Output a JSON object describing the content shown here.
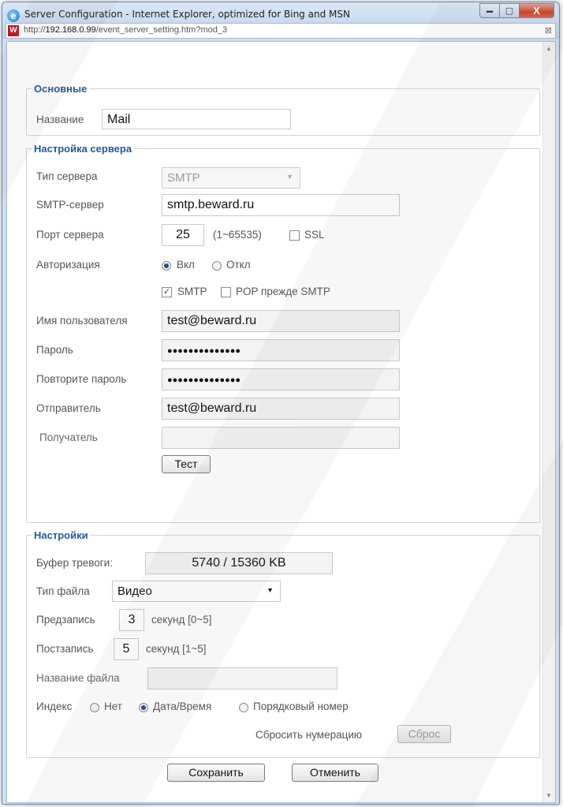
{
  "window": {
    "title": "Server Configuration - Internet Explorer, optimized for Bing and MSN",
    "url_prefix": "http://",
    "url_host": "192.168.0.99",
    "url_path": "/event_server_setting.htm?mod_3",
    "controls": {
      "minimize": "▬",
      "maximize": "▢",
      "close": "X"
    }
  },
  "basic": {
    "legend": "Основные",
    "name_label": "Название",
    "name_value": "Mail"
  },
  "server": {
    "legend": "Настройка сервера",
    "type_label": "Тип сервера",
    "type_value": "SMTP",
    "smtp_label": "SMTP-сервер",
    "smtp_value": "smtp.beward.ru",
    "port_label": "Порт сервера",
    "port_value": "25",
    "port_range": "(1~65535)",
    "ssl_label": "SSL",
    "ssl_checked": false,
    "auth_label": "Авторизация",
    "auth_on": "Вкл",
    "auth_off": "Откл",
    "auth_selected": "on",
    "smtp_check_label": "SMTP",
    "smtp_checked": true,
    "pop_label": "POP прежде SMTP",
    "pop_checked": false,
    "user_label": "Имя пользователя",
    "user_value": "test@beward.ru",
    "password_label": "Пароль",
    "password_value": "●●●●●●●●●●●●●●",
    "repeat_label": "Повторите пароль",
    "repeat_value": "●●●●●●●●●●●●●●",
    "sender_label": "Отправитель",
    "sender_value": "test@beward.ru",
    "recipient_label": "Получатель",
    "recipient_value": "",
    "test_button": "Тест"
  },
  "settings": {
    "legend": "Настройки",
    "buffer_label": "Буфер тревоги:",
    "buffer_value": "5740 / 15360 KB",
    "filetype_label": "Тип файла",
    "filetype_value": "Видео",
    "pre_label": "Предзапись",
    "pre_value": "3",
    "pre_unit": "секунд [0~5]",
    "post_label": "Постзапись",
    "post_value": "5",
    "post_unit": "секунд [1~5]",
    "filename_label": "Название файла",
    "filename_value": "",
    "index_label": "Индекс",
    "index_none": "Нет",
    "index_datetime": "Дата/Время",
    "index_serial": "Порядковый номер",
    "index_selected": "datetime",
    "reset_label": "Сбросить нумерацию",
    "reset_button": "Сброс"
  },
  "footer": {
    "save_button": "Сохранить",
    "cancel_button": "Отменить"
  },
  "colors": {
    "legend": "#1f5a9c",
    "titlebar": "#bcd2ea",
    "close_button": "#c8452b"
  },
  "icons": {
    "browser": "internet-explorer-icon",
    "site": "beward-favicon-icon",
    "compat": "compatibility-view-icon"
  }
}
